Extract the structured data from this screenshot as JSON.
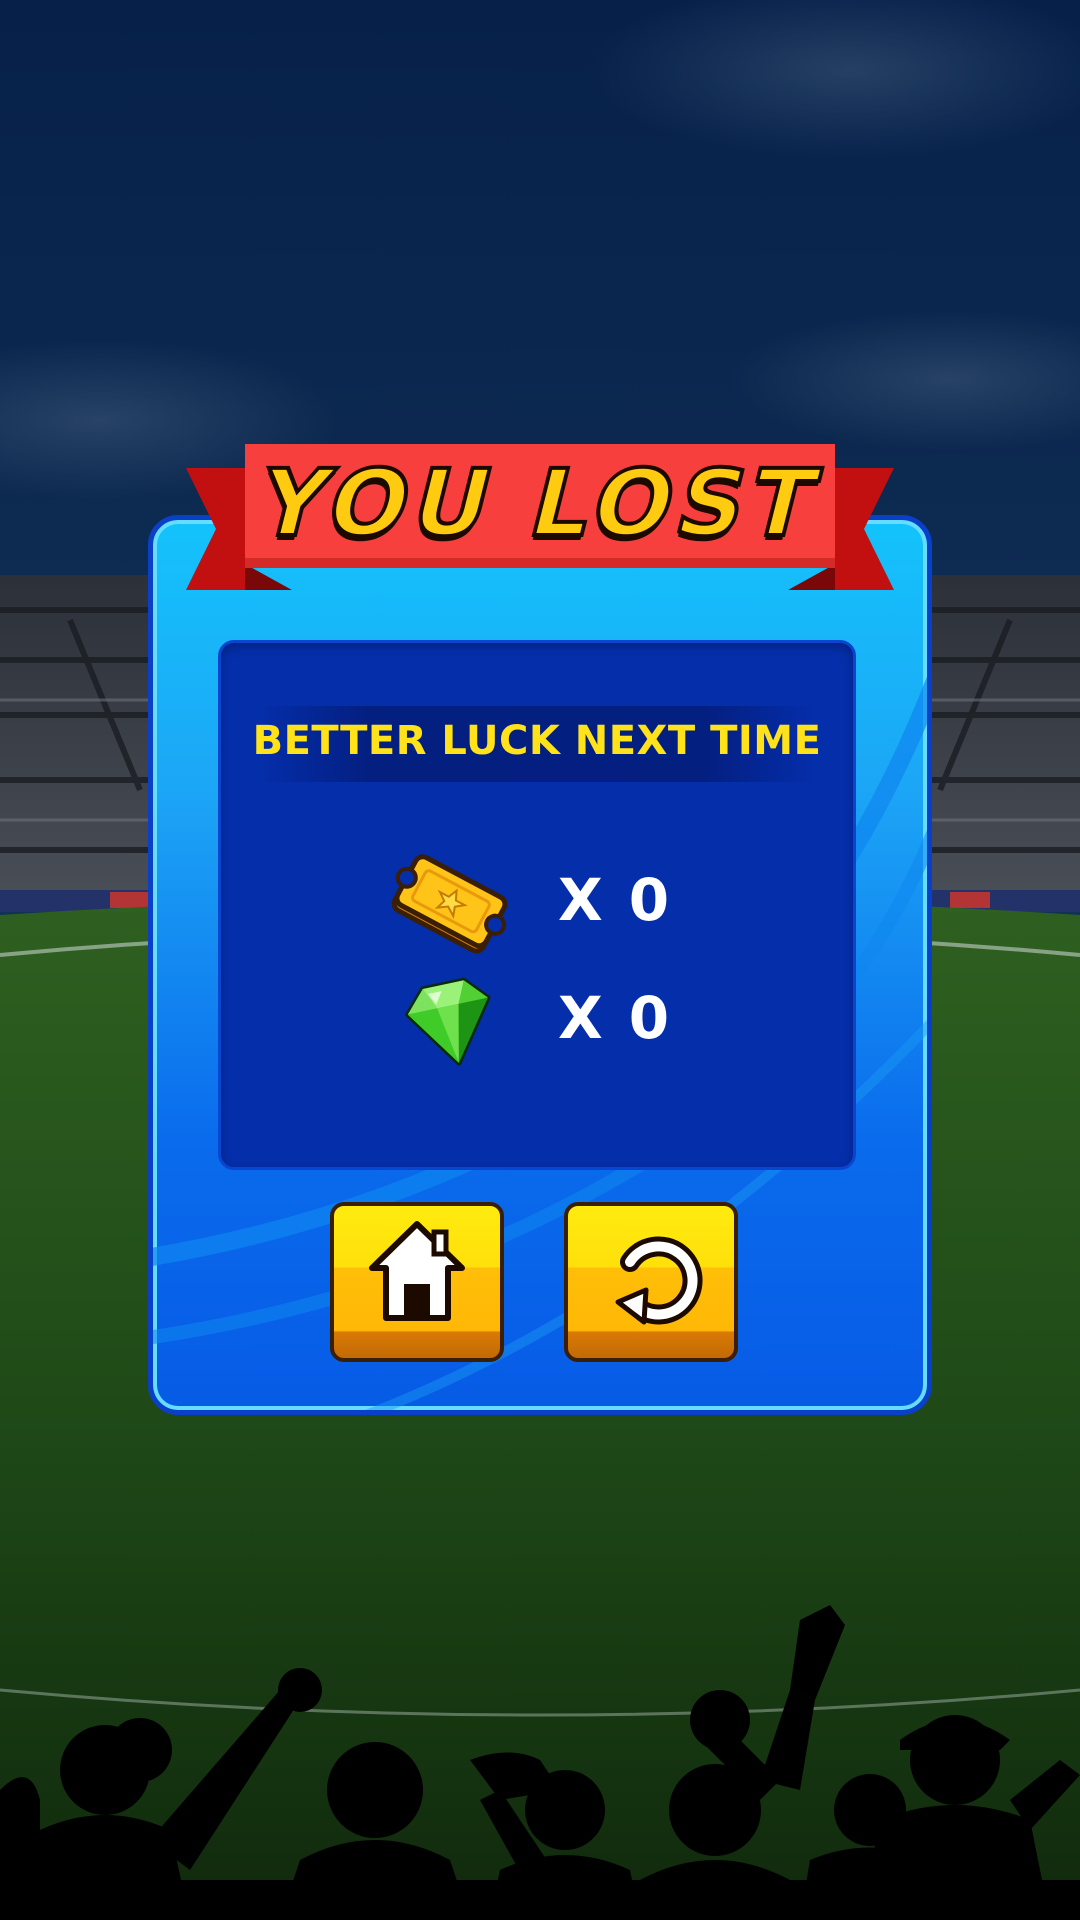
{
  "popup": {
    "title": "YOU LOST",
    "subtitle": "BETTER LUCK NEXT TIME"
  },
  "rewards": [
    {
      "icon": "ticket-icon",
      "prefix": "X",
      "value": "0"
    },
    {
      "icon": "gem-icon",
      "prefix": "X",
      "value": "0"
    }
  ],
  "buttons": {
    "home": {
      "icon": "home-icon"
    },
    "retry": {
      "icon": "retry-icon"
    }
  },
  "colors": {
    "banner_red": "#f7403e",
    "title_yellow": "#ffcb10",
    "panel_blue": "#14c3fb",
    "inner_navy": "#052eab",
    "subtitle_yellow": "#ffe21a",
    "button_yellow": "#ffe00a"
  }
}
